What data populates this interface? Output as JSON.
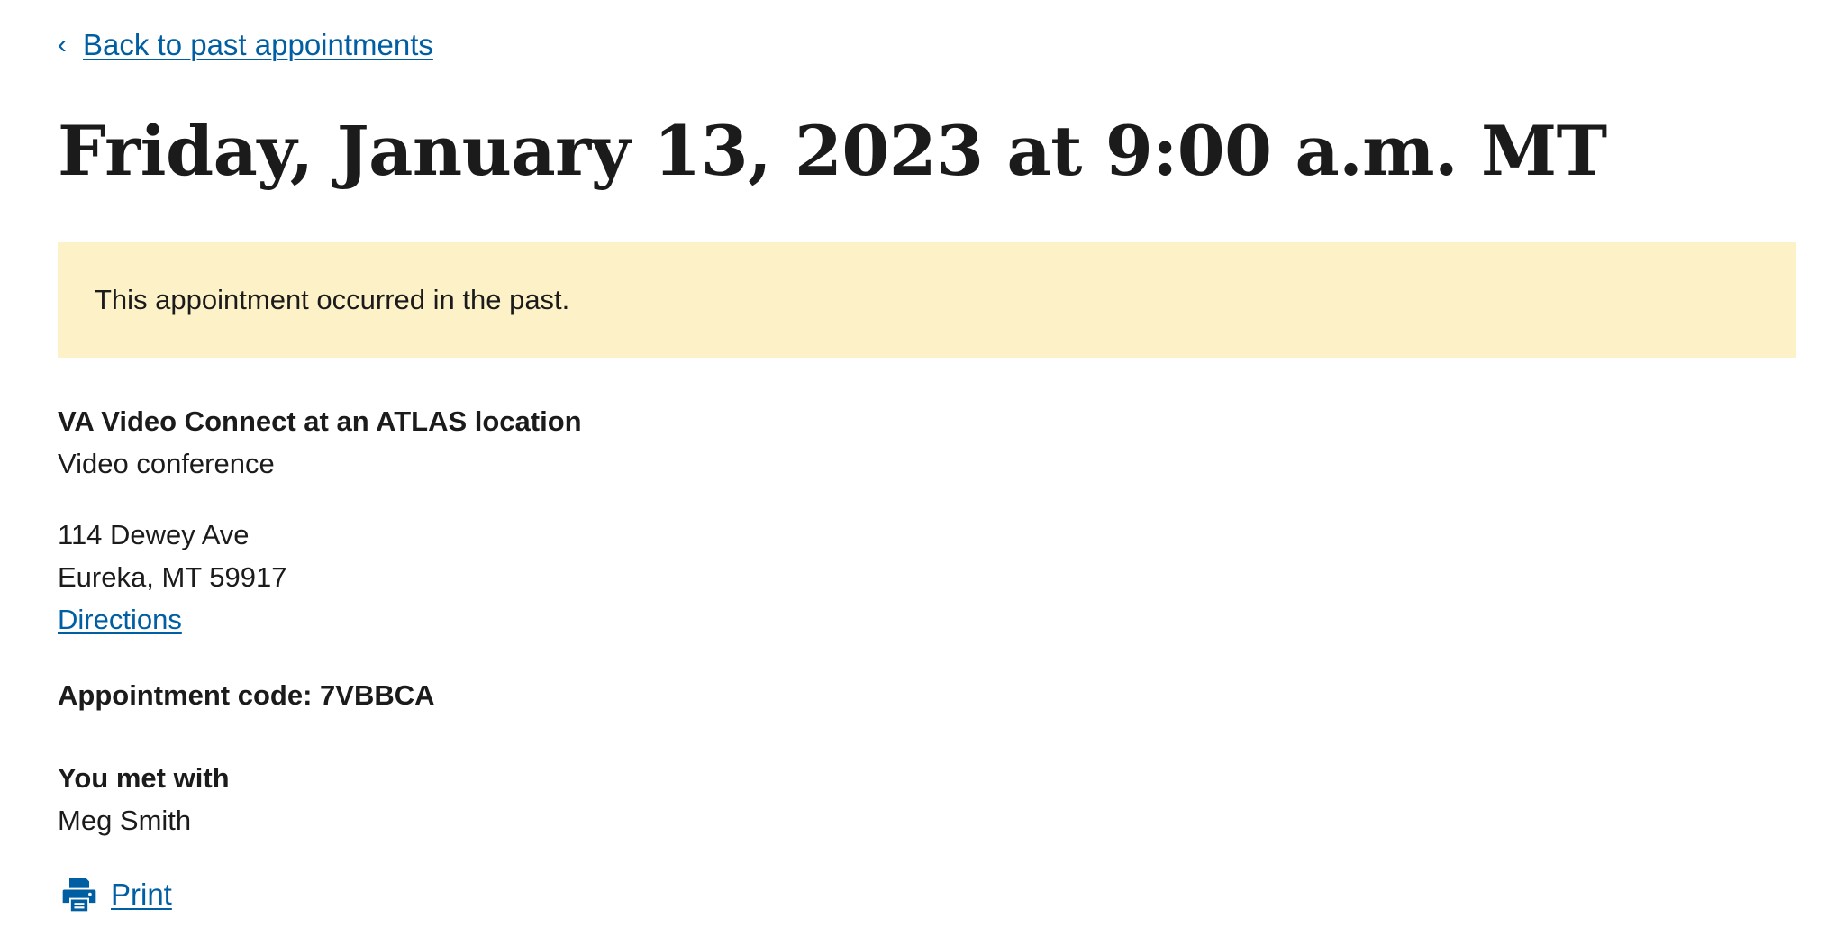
{
  "nav": {
    "back_chevron": "‹",
    "back_label": "Back to past appointments"
  },
  "header": {
    "title": "Friday, January 13, 2023 at 9:00 a.m. MT"
  },
  "alert": {
    "text": "This appointment occurred in the past."
  },
  "appointment": {
    "type_title": "VA Video Connect at an ATLAS location",
    "type_subtitle": "Video conference",
    "address_line1": "114 Dewey Ave",
    "address_line2": "Eureka, MT 59917",
    "directions_label": "Directions",
    "code_label": "Appointment code: 7VBBCA",
    "met_with_label": "You met with",
    "met_with_name": "Meg Smith"
  },
  "actions": {
    "print_label": "Print",
    "print_icon": "printer-icon"
  },
  "colors": {
    "link": "#005ea2",
    "text": "#1b1b1b",
    "alert_bg": "#fdf1c7"
  }
}
